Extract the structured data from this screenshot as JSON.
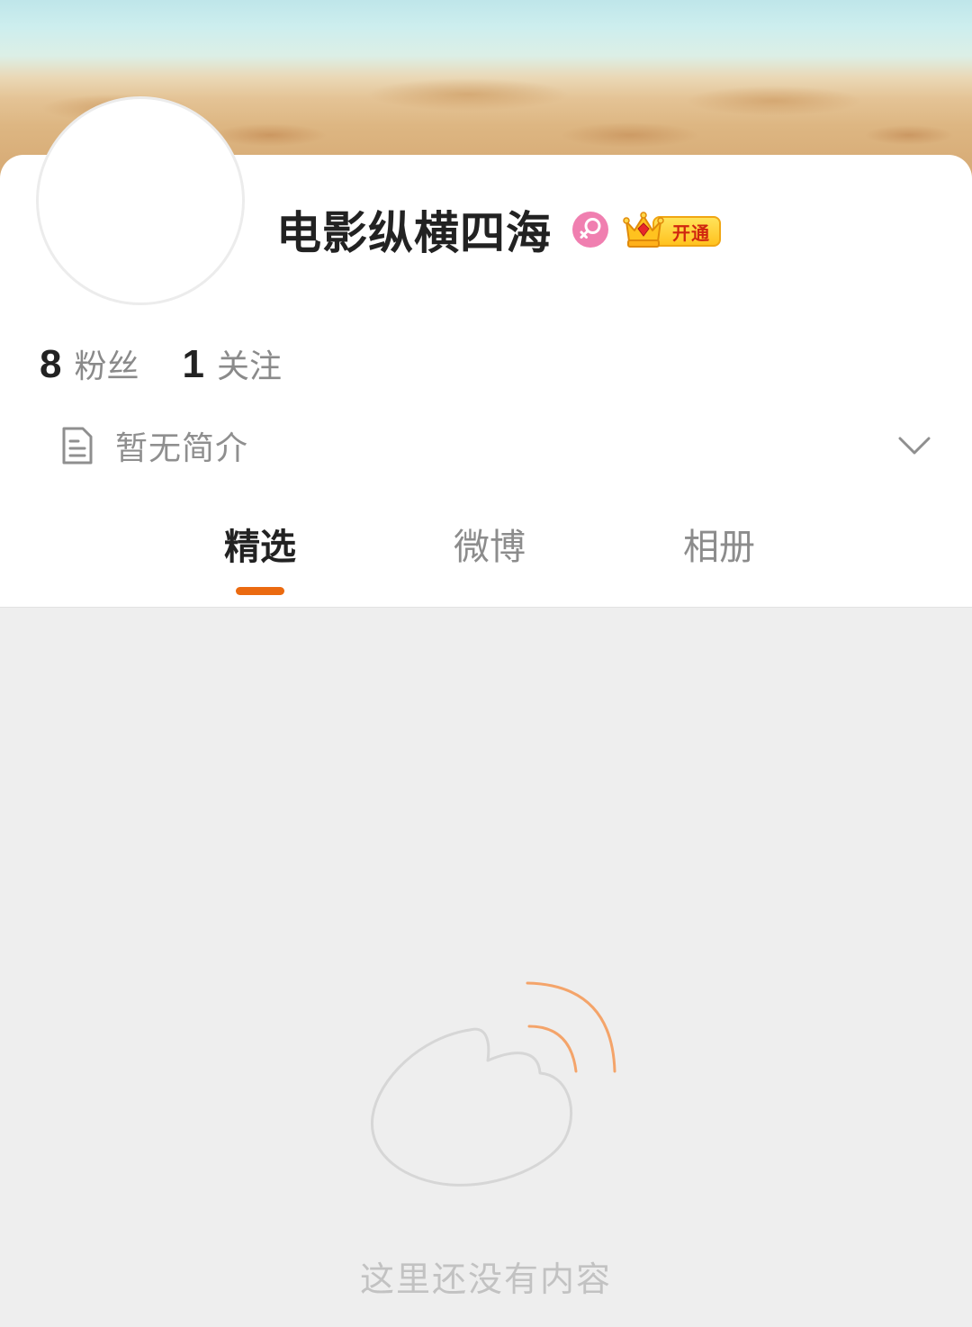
{
  "profile": {
    "name": "电影纵横四海",
    "gender_icon": "female-icon",
    "vip_badge_label": "开通",
    "stats": [
      {
        "count": "8",
        "label": "粉丝"
      },
      {
        "count": "1",
        "label": "关注"
      }
    ],
    "bio": "暂无简介"
  },
  "tabs": [
    {
      "label": "精选",
      "active": true
    },
    {
      "label": "微博",
      "active": false
    },
    {
      "label": "相册",
      "active": false
    }
  ],
  "empty_state": {
    "message": "这里还没有内容",
    "icon": "weibo-logo-icon"
  },
  "colors": {
    "accent": "#eb6a10",
    "gender_pink": "#f07fb0",
    "vip_gold": "#ffc21f",
    "vip_text": "#d0260f",
    "background": "#eeeeee"
  }
}
